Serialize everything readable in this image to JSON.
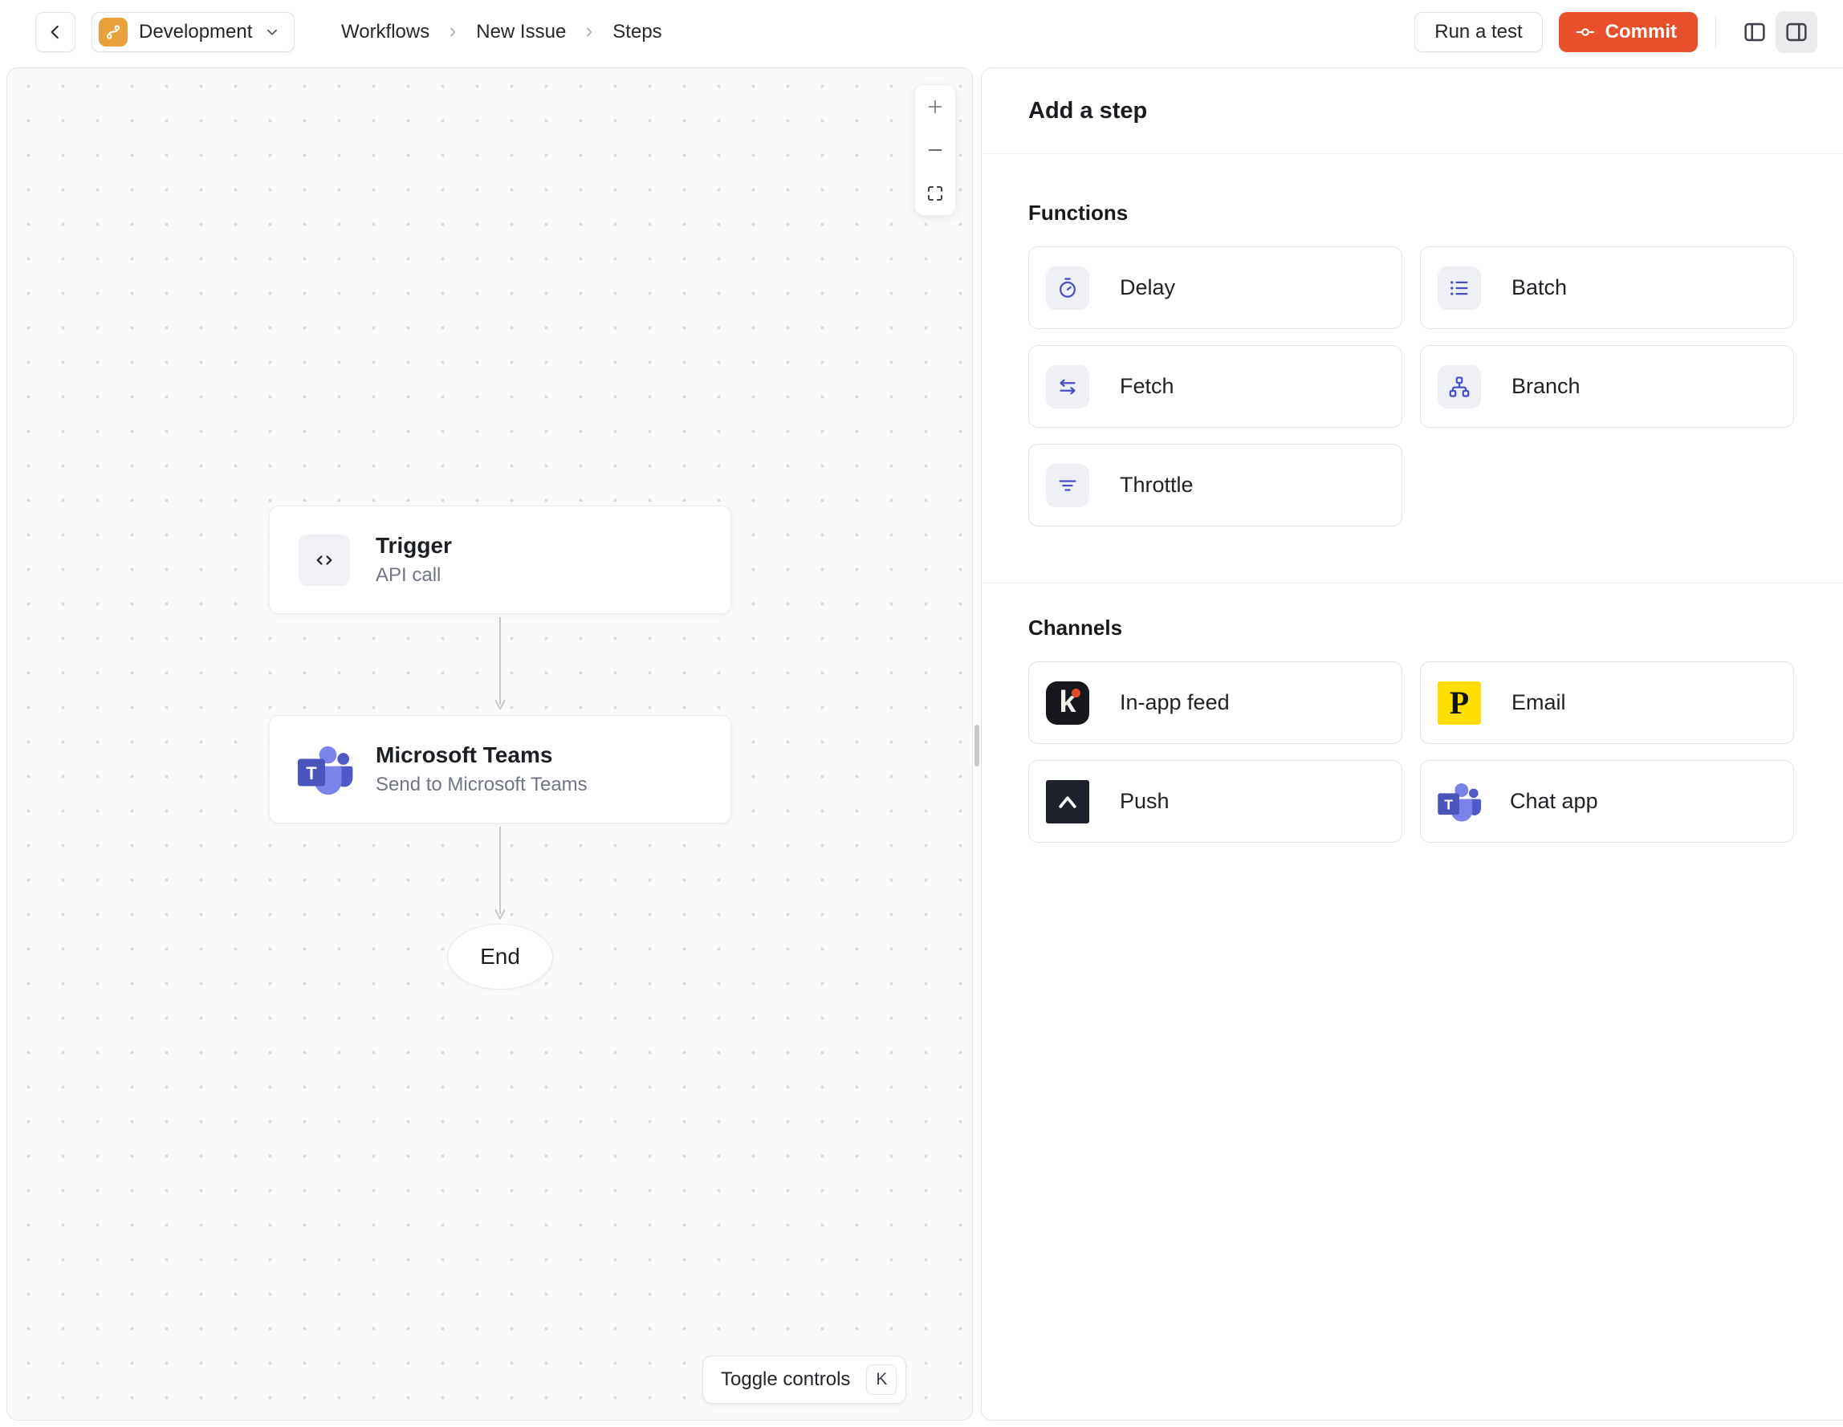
{
  "topbar": {
    "environment_label": "Development",
    "breadcrumb": [
      "Workflows",
      "New Issue",
      "Steps"
    ],
    "run_test_label": "Run a test",
    "commit_label": "Commit"
  },
  "canvas": {
    "zoom_in": "+",
    "zoom_out": "−",
    "nodes": {
      "trigger": {
        "title": "Trigger",
        "subtitle": "API call"
      },
      "teams": {
        "title": "Microsoft Teams",
        "subtitle": "Send to Microsoft Teams"
      },
      "end": {
        "label": "End"
      }
    },
    "toggle_controls_label": "Toggle controls",
    "toggle_controls_shortcut": "K"
  },
  "panel": {
    "title": "Add a step",
    "functions": {
      "label": "Functions",
      "items": [
        {
          "label": "Delay",
          "icon": "stopwatch-icon"
        },
        {
          "label": "Batch",
          "icon": "list-icon"
        },
        {
          "label": "Fetch",
          "icon": "transfer-arrows-icon"
        },
        {
          "label": "Branch",
          "icon": "hierarchy-icon"
        },
        {
          "label": "Throttle",
          "icon": "throttle-lines-icon"
        }
      ]
    },
    "channels": {
      "label": "Channels",
      "items": [
        {
          "label": "In-app feed",
          "icon": "knock-logo"
        },
        {
          "label": "Email",
          "icon": "postmark-logo"
        },
        {
          "label": "Push",
          "icon": "expo-logo"
        },
        {
          "label": "Chat app",
          "icon": "ms-teams-logo"
        }
      ]
    }
  },
  "icons": {
    "teams_t": "T",
    "knock_letter": "k",
    "postmark_letter": "P"
  },
  "colors": {
    "commit_accent": "#e8502b",
    "environment_icon": "#e9a23b",
    "function_icon": "#474fc6",
    "knock_dot": "#e5492b",
    "postmark_yellow": "#ffde00",
    "teams_dark": "#4b53bc",
    "teams_primary": "#5059c9",
    "teams_light": "#7b83eb"
  }
}
